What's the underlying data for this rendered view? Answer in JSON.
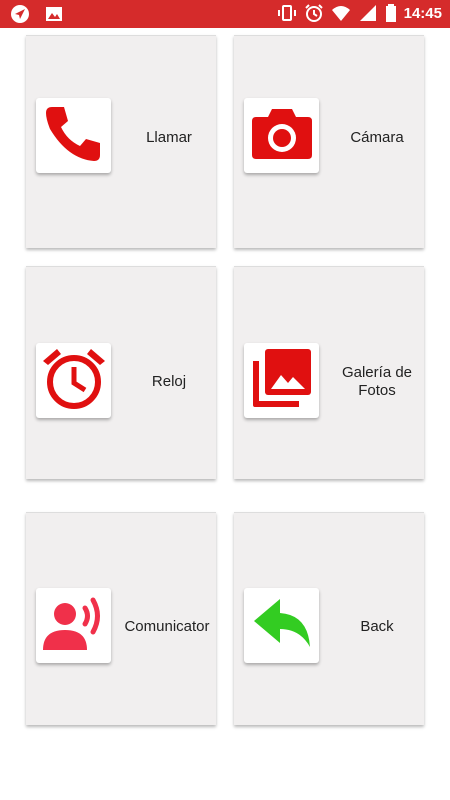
{
  "status_bar": {
    "time": "14:45",
    "background": "#d52b2b",
    "left_icons": [
      "navigation-icon",
      "image-icon"
    ],
    "right_icons": [
      "vibrate-icon",
      "alarm-icon",
      "wifi-icon",
      "signal-icon",
      "battery-icon"
    ]
  },
  "tiles": [
    {
      "label": "Llamar",
      "icon": "phone-icon",
      "icon_color": "#e01010"
    },
    {
      "label": "Cámara",
      "icon": "camera-icon",
      "icon_color": "#e01010"
    },
    {
      "label": "Reloj",
      "icon": "alarm-clock-icon",
      "icon_color": "#e01010"
    },
    {
      "label_line1": "Galería de",
      "label_line2": "Fotos",
      "icon": "photo-gallery-icon",
      "icon_color": "#e01010"
    },
    {
      "label": "Comunicator",
      "icon": "speaking-person-icon",
      "icon_color": "#f0304a"
    },
    {
      "label": "Back",
      "icon": "back-arrow-icon",
      "icon_color": "#33cc22"
    }
  ]
}
